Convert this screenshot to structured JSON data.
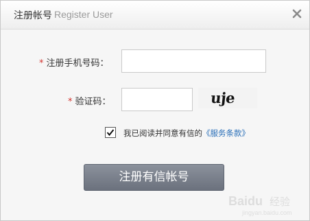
{
  "dialog": {
    "title_cn": "注册帐号",
    "title_en": "Register User"
  },
  "form": {
    "required_mark": "*",
    "phone_label": "注册手机号码：",
    "phone_value": "",
    "captcha_label": "验证码：",
    "captcha_value": "",
    "captcha_image_text": "uje"
  },
  "agreement": {
    "checked": true,
    "text": "我已阅读并同意有信的",
    "link": "《服务条款》"
  },
  "submit_label": "注册有信帐号",
  "watermark": {
    "brand": "Baidu",
    "suffix": "经验",
    "url": "jingyan.baidu.com"
  },
  "colors": {
    "required": "#d3332e",
    "link": "#2a6fb8",
    "button": "#7a808b"
  }
}
